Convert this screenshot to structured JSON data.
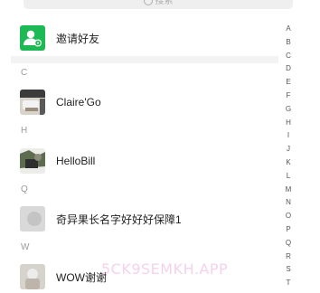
{
  "search": {
    "placeholder": "搜索"
  },
  "invite": {
    "label": "邀请好友"
  },
  "sections": [
    {
      "letter": "C",
      "contacts": [
        {
          "name": "Claire'Go"
        }
      ]
    },
    {
      "letter": "H",
      "contacts": [
        {
          "name": "HelloBill"
        }
      ]
    },
    {
      "letter": "Q",
      "contacts": [
        {
          "name": "奇异果长名字好好好保障1"
        }
      ]
    },
    {
      "letter": "W",
      "contacts": [
        {
          "name": "WOW谢谢"
        }
      ]
    }
  ],
  "index_letters": [
    "A",
    "B",
    "C",
    "D",
    "E",
    "F",
    "G",
    "H",
    "I",
    "J",
    "K",
    "L",
    "M",
    "N",
    "O",
    "P",
    "Q",
    "R",
    "S",
    "T"
  ],
  "watermark": "5CK9SEMKH.APP",
  "colors": {
    "accent": "#1db954",
    "section_text": "#9a9a9a"
  }
}
